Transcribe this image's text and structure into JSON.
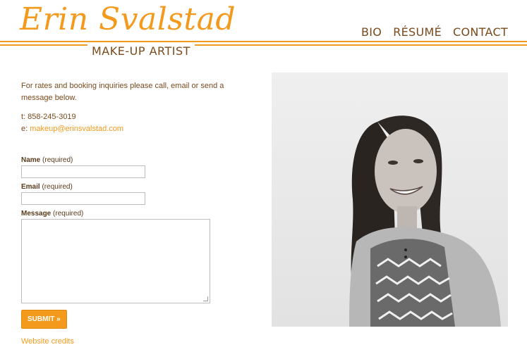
{
  "brand": {
    "name": "Erin Svalstad",
    "tagline": "MAKE-UP ARTIST",
    "accent_color": "#f39a1c",
    "text_color": "#7a4a1c"
  },
  "nav": {
    "items": [
      {
        "label": "BIO"
      },
      {
        "label": "RÉSUMÉ"
      },
      {
        "label": "CONTACT"
      }
    ]
  },
  "main": {
    "intro": "For rates and booking inquiries please call, email or send a message below.",
    "phone": "t: 858-245-3019",
    "email_prefix": "e: ",
    "email": "makeup@erinsvalstad.com"
  },
  "form": {
    "name_label": "Name",
    "name_required": "(required)",
    "email_label": "Email",
    "email_required": "(required)",
    "message_label": "Message",
    "message_required": "(required)",
    "submit_label": "SUBMIT »"
  },
  "footer": {
    "credits": "Website credits"
  },
  "photo": {
    "icon": "portrait-photo"
  }
}
